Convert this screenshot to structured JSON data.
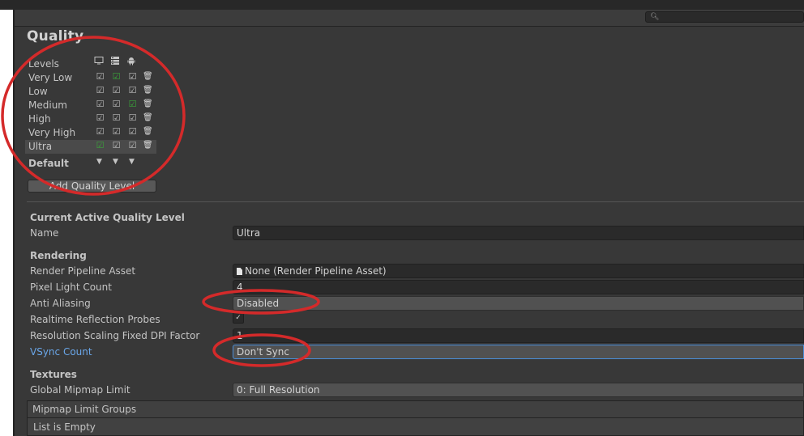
{
  "page": {
    "title": "Quality",
    "search_icon": "magnifier-icon"
  },
  "levels": {
    "header": "Levels",
    "platform_icons": [
      "monitor-icon",
      "server-icon",
      "android-icon"
    ],
    "items": [
      {
        "name": "Very Low",
        "checks": [
          true,
          true,
          true
        ],
        "green": 1
      },
      {
        "name": "Low",
        "checks": [
          true,
          true,
          true
        ],
        "green": -1
      },
      {
        "name": "Medium",
        "checks": [
          true,
          true,
          true
        ],
        "green": 2
      },
      {
        "name": "High",
        "checks": [
          true,
          true,
          true
        ],
        "green": -1
      },
      {
        "name": "Very High",
        "checks": [
          true,
          true,
          true
        ],
        "green": -1
      },
      {
        "name": "Ultra",
        "checks": [
          true,
          true,
          true
        ],
        "green": 0,
        "selected": true
      }
    ],
    "default_label": "Default",
    "add_button": "Add Quality Level"
  },
  "current": {
    "section": "Current Active Quality Level",
    "name_label": "Name",
    "name_value": "Ultra"
  },
  "rendering": {
    "section": "Rendering",
    "pipeline_label": "Render Pipeline Asset",
    "pipeline_value": "None (Render Pipeline Asset)",
    "pixel_light_label": "Pixel Light Count",
    "pixel_light_value": "4",
    "aa_label": "Anti Aliasing",
    "aa_value": "Disabled",
    "rrp_label": "Realtime Reflection Probes",
    "rrp_checked": true,
    "dpi_label": "Resolution Scaling Fixed DPI Factor",
    "dpi_value": "1",
    "vsync_label": "VSync Count",
    "vsync_value": "Don't Sync"
  },
  "textures": {
    "section": "Textures",
    "mipmap_label": "Global Mipmap Limit",
    "mipmap_value": "0: Full Resolution",
    "groups_header": "Mipmap Limit Groups",
    "groups_empty": "List is Empty"
  },
  "colors": {
    "annotation_red": "#d42a2a",
    "check_green": "#3aa43a",
    "focus_blue": "#6aa6e8"
  }
}
